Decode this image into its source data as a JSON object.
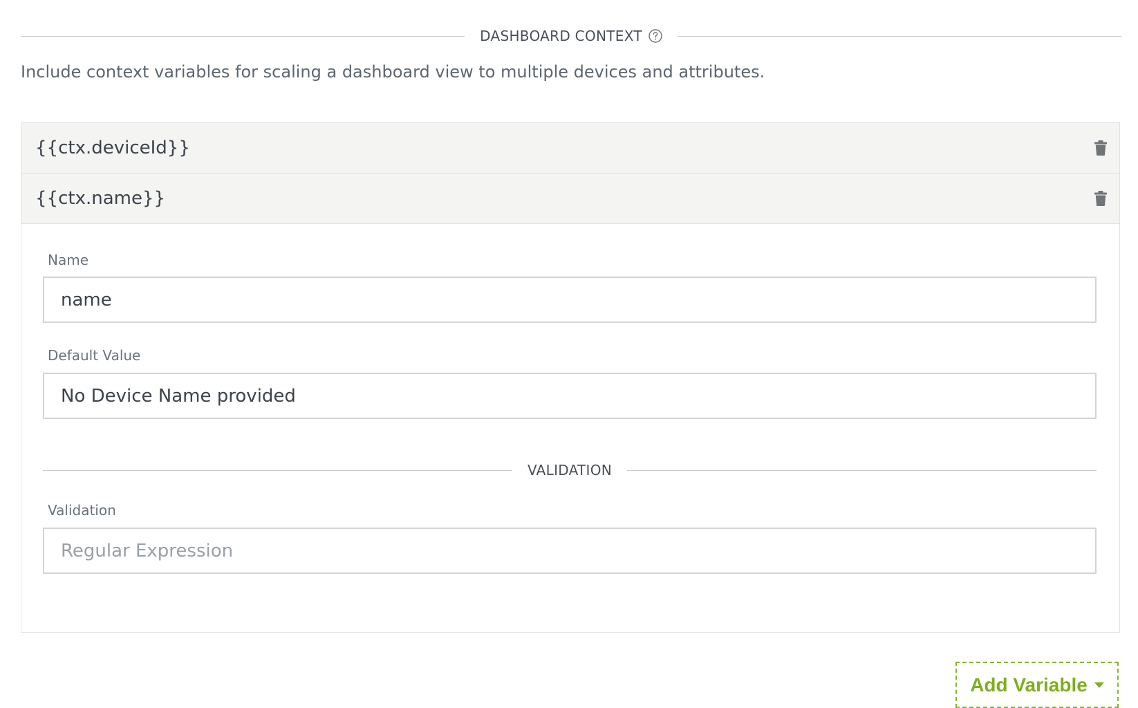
{
  "section": {
    "title": "DASHBOARD CONTEXT",
    "help_icon": "question-circle-icon",
    "description": "Include context variables for scaling a dashboard view to multiple devices and attributes."
  },
  "variables": [
    {
      "label": "{{ctx.deviceId}}",
      "delete_icon": "trash-icon",
      "expanded": false
    },
    {
      "label": "{{ctx.name}}",
      "delete_icon": "trash-icon",
      "expanded": true
    }
  ],
  "editor": {
    "name_label": "Name",
    "name_value": "name",
    "default_label": "Default Value",
    "default_value": "No Device Name provided",
    "validation_header": "VALIDATION",
    "validation_label": "Validation",
    "validation_value": "",
    "validation_placeholder": "Regular Expression"
  },
  "add_button": {
    "label": "Add Variable",
    "icon": "caret-down-icon",
    "color": "#7fae1f"
  },
  "colors": {
    "row_background": "#f4f4f2",
    "border": "#e1e1e1",
    "text": "#3c434b",
    "muted_text": "#6b737c"
  }
}
